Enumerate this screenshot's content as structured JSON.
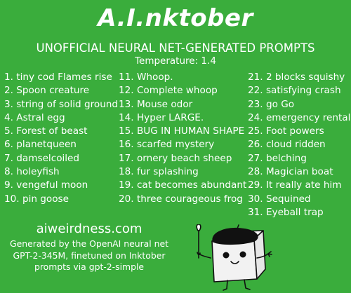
{
  "header": {
    "title": "A.I.nktober",
    "subtitle": "UNOFFICIAL NEURAL NET-GENERATED PROMPTS",
    "temperature": "Temperature: 1.4"
  },
  "prompts": {
    "column1": [
      "1. tiny cod Flames rise",
      "2. Spoon creature",
      "3. string of solid ground",
      "4. Astral egg",
      "5. Forest of beast",
      "6. planetqueen",
      "7. damselcoiled",
      "8. holeyfish",
      "9. vengeful moon",
      "10. pin goose"
    ],
    "column2": [
      "11. Whoop.",
      "12. Complete whoop",
      "13. Mouse odor",
      "14. Hyper LARGE.",
      "15. BUG IN HUMAN SHAPE",
      "16. scarfed mystery",
      "17. ornery beach sheep",
      "18. fur splashing",
      "19. cat becomes abundant",
      "20. three courageous frog"
    ],
    "column3": [
      "21. 2 blocks squishy",
      "22. satisfying crash",
      "23. go Go",
      "24. emergency rental",
      "25. Foot powers",
      "26. cloud ridden",
      "27. belching",
      "28. Magician boat",
      "29. It really ate him",
      "30. Sequined",
      "31. Eyeball trap"
    ]
  },
  "footer": {
    "website": "aiweirdness.com",
    "credit_lines": [
      "Generated by the OpenAI neural net",
      "GPT-2-345M, finetuned on Inktober",
      "prompts via gpt-2-simple"
    ]
  },
  "colors": {
    "background": "#3aad3c",
    "text": "#ffffff",
    "ink": "#111111"
  },
  "illustration": {
    "icon": "beret-cube-artist-icon"
  }
}
